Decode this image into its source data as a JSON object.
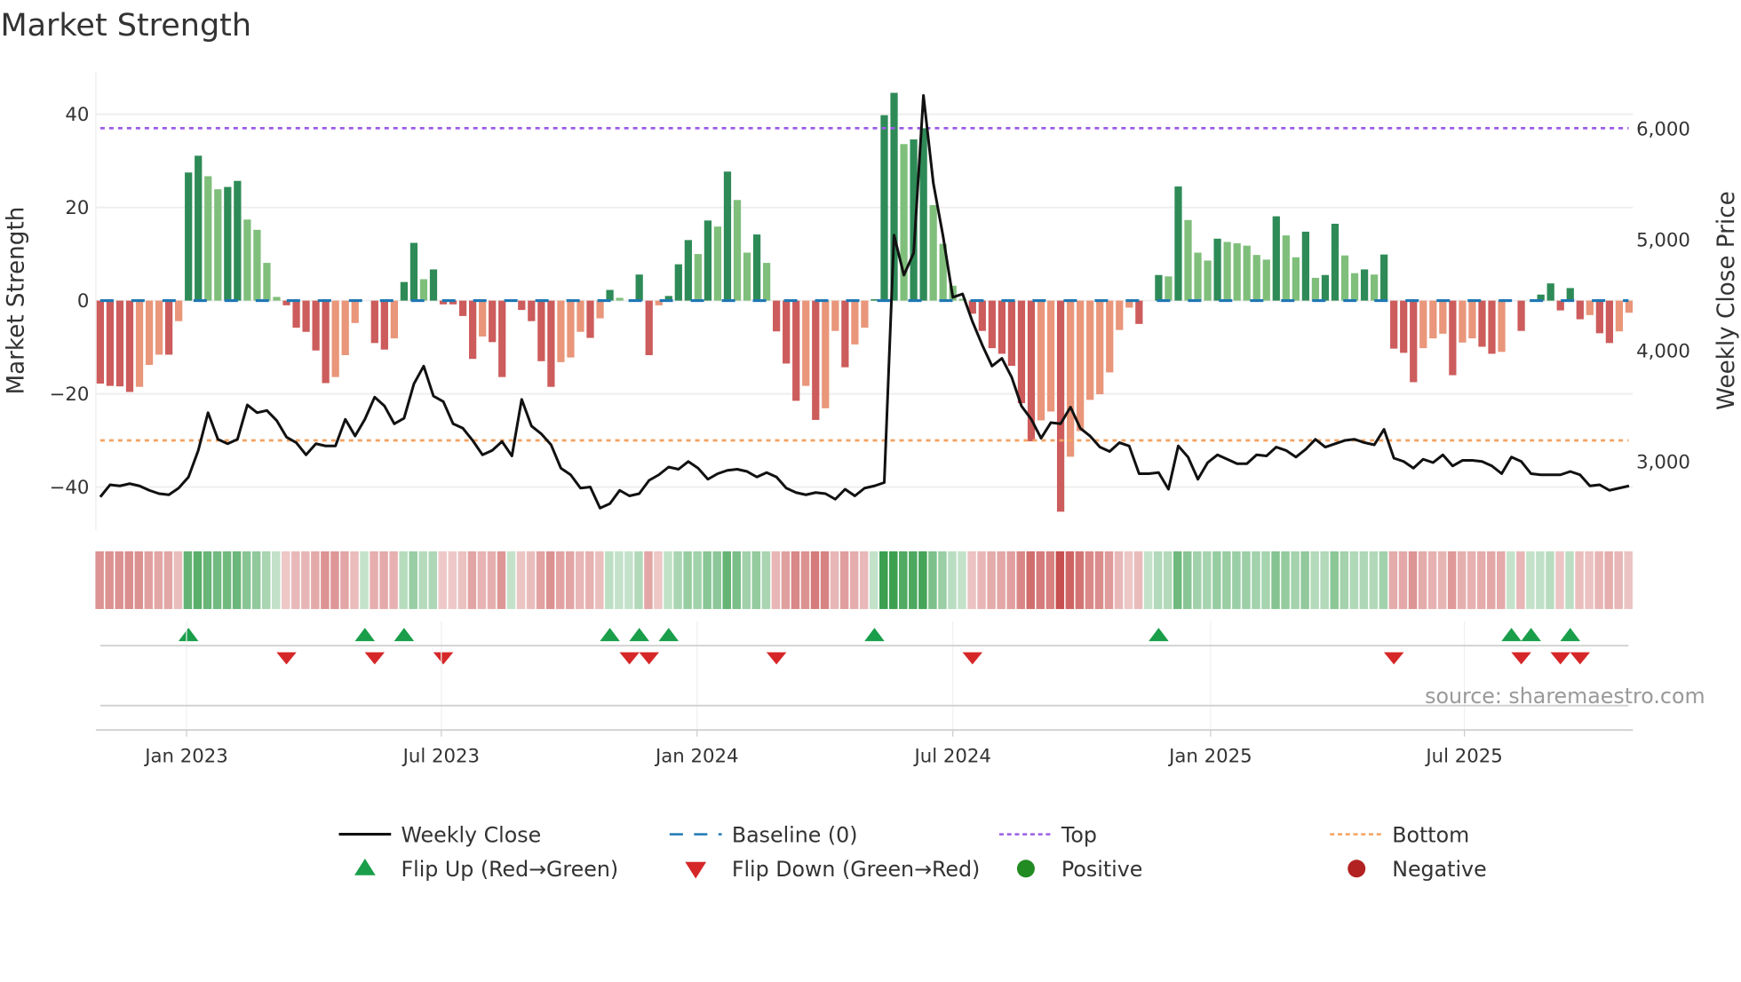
{
  "chart_data": {
    "type": "bar",
    "title": "Market Strength",
    "ylabel": "Market Strength",
    "y2label": "Weekly Close Price",
    "ylim": [
      -50,
      50
    ],
    "y2lim": [
      2450,
      6550
    ],
    "yticks": [
      40,
      20,
      0,
      -20,
      -40
    ],
    "yticklabels": [
      "40",
      "20",
      "0",
      "−20",
      "−40"
    ],
    "y2ticks": [
      6000,
      5000,
      4000,
      3000
    ],
    "y2ticklabels": [
      "6,000",
      "5,000",
      "4,000",
      "3,000"
    ],
    "xticks": [
      {
        "week": 8.8,
        "label": "Jan 2023"
      },
      {
        "week": 34.8,
        "label": "Jul 2023"
      },
      {
        "week": 60.9,
        "label": "Jan 2024"
      },
      {
        "week": 87.0,
        "label": "Jul 2024"
      },
      {
        "week": 113.3,
        "label": "Jan 2025"
      },
      {
        "week": 139.2,
        "label": "Jul 2025"
      }
    ],
    "top": 37,
    "bottom": -30,
    "baseline": 0,
    "strength": [
      -17.8,
      -18.3,
      -18.4,
      -19.6,
      -18.5,
      -13.8,
      -11.6,
      -11.6,
      -4.4,
      27.5,
      31.1,
      26.7,
      23.9,
      24.4,
      25.7,
      17.4,
      15.2,
      8.1,
      0.8,
      -1,
      -5.8,
      -6.7,
      -10.7,
      -17.7,
      -16.4,
      -11.7,
      -4.8,
      0,
      -9.1,
      -10.5,
      -8.1,
      4,
      12.4,
      4.6,
      6.7,
      -0.8,
      -0.8,
      -3.3,
      -12.5,
      -7.7,
      -8.9,
      -16.4,
      0,
      -2,
      -4.4,
      -13,
      -18.5,
      -13.2,
      -12.2,
      -6.7,
      -8,
      -3.8,
      2.3,
      0.6,
      0,
      5.6,
      -11.7,
      -1,
      1,
      7.8,
      13,
      10,
      17.2,
      15.9,
      27.7,
      21.6,
      10.3,
      14.2,
      8.1,
      -6.6,
      -13.5,
      -21.5,
      -18.3,
      -25.6,
      -23.1,
      -6.5,
      -14.3,
      -9.4,
      -5.8,
      0.3,
      39.8,
      44.6,
      33.6,
      34.6,
      37,
      20.5,
      12.2,
      3.2,
      0.4,
      -2.8,
      -6.5,
      -10.2,
      -11.4,
      -14,
      -22,
      -30.2,
      -25.7,
      -23.8,
      -45.3,
      -33.5,
      -28,
      -21.3,
      -20.1,
      -15.4,
      -6.3,
      -1.5,
      -5,
      0,
      5.5,
      5.2,
      24.5,
      17.3,
      10.3,
      8.6,
      13.3,
      12.6,
      12.3,
      11.8,
      9.8,
      8.8,
      18.1,
      14,
      9.3,
      14.8,
      4.9,
      5.5,
      16.5,
      9.7,
      5.9,
      6.7,
      5.6,
      9.9,
      -10.3,
      -11.2,
      -17.5,
      -10.2,
      -8.1,
      -7.1,
      -16,
      -9,
      -8.1,
      -9.9,
      -11.4,
      -11,
      0,
      -6.5,
      0,
      1.3,
      3.7,
      -2.1,
      2.7,
      -4,
      -3.1,
      -7,
      -9.1,
      -6.6,
      -2.6
    ],
    "strong": [
      1,
      1,
      1,
      1,
      0,
      0,
      0,
      1,
      0,
      1,
      1,
      0,
      0,
      1,
      1,
      0,
      0,
      0,
      0,
      1,
      1,
      1,
      1,
      1,
      0,
      0,
      0,
      0,
      1,
      1,
      0,
      1,
      1,
      0,
      1,
      1,
      1,
      1,
      1,
      0,
      1,
      1,
      0,
      1,
      1,
      1,
      1,
      0,
      0,
      0,
      1,
      0,
      1,
      0,
      0,
      1,
      1,
      0,
      1,
      1,
      1,
      0,
      1,
      0,
      1,
      0,
      0,
      1,
      0,
      1,
      1,
      1,
      0,
      1,
      0,
      0,
      1,
      0,
      0,
      1,
      1,
      1,
      0,
      1,
      1,
      0,
      0,
      0,
      0,
      1,
      1,
      1,
      1,
      1,
      1,
      1,
      0,
      0,
      1,
      0,
      0,
      0,
      0,
      0,
      0,
      0,
      1,
      0,
      1,
      0,
      1,
      0,
      0,
      0,
      1,
      0,
      0,
      0,
      0,
      0,
      1,
      0,
      0,
      1,
      0,
      1,
      1,
      0,
      0,
      1,
      0,
      1,
      1,
      1,
      1,
      0,
      0,
      0,
      1,
      0,
      0,
      1,
      1,
      0,
      0,
      1,
      0,
      1,
      1,
      1,
      1,
      1,
      0,
      1,
      1,
      0,
      0
    ],
    "weekly_close": [
      2680,
      2790,
      2780,
      2800,
      2780,
      2740,
      2710,
      2700,
      2760,
      2860,
      3100,
      3440,
      3200,
      3160,
      3200,
      3510,
      3440,
      3460,
      3370,
      3220,
      3170,
      3060,
      3160,
      3140,
      3140,
      3380,
      3230,
      3380,
      3580,
      3500,
      3340,
      3390,
      3700,
      3860,
      3590,
      3540,
      3340,
      3300,
      3190,
      3060,
      3100,
      3180,
      3050,
      3560,
      3320,
      3250,
      3150,
      2940,
      2880,
      2760,
      2770,
      2580,
      2620,
      2740,
      2690,
      2710,
      2830,
      2880,
      2950,
      2930,
      3000,
      2940,
      2840,
      2890,
      2920,
      2930,
      2910,
      2860,
      2900,
      2860,
      2760,
      2720,
      2700,
      2720,
      2710,
      2660,
      2750,
      2690,
      2760,
      2780,
      2810,
      5040,
      4680,
      4880,
      6300,
      5510,
      5030,
      4480,
      4510,
      4260,
      4050,
      3860,
      3930,
      3760,
      3500,
      3380,
      3210,
      3350,
      3340,
      3490,
      3300,
      3230,
      3130,
      3090,
      3170,
      3140,
      2890,
      2890,
      2900,
      2750,
      3140,
      3040,
      2840,
      2990,
      3060,
      3020,
      2980,
      2980,
      3060,
      3050,
      3130,
      3100,
      3040,
      3110,
      3200,
      3130,
      3160,
      3190,
      3200,
      3170,
      3150,
      3290,
      3030,
      3000,
      2940,
      3020,
      2990,
      3060,
      2960,
      3010,
      3010,
      3000,
      2960,
      2890,
      3040,
      3000,
      2890,
      2880,
      2880,
      2880,
      2910,
      2880,
      2780,
      2790,
      2740,
      2760,
      2780
    ],
    "flip_up_weeks": [
      9,
      27,
      31,
      52,
      55,
      58,
      79,
      108,
      144,
      146,
      150
    ],
    "flip_down_weeks": [
      19,
      28,
      35,
      54,
      56,
      69,
      89,
      132,
      145,
      149,
      151
    ],
    "colors": {
      "strong_pos": "#2e8b57",
      "weak_pos": "#7fbf7b",
      "strong_neg": "#cd5c5c",
      "weak_neg": "#e9967a",
      "baseline": "#1f77b4",
      "top": "#9b5de5",
      "bottom": "#f4a261",
      "line": "#111111",
      "flip_up": "#1a9e4a",
      "flip_down": "#d62728",
      "positive": "#228b22",
      "negative": "#b22222"
    },
    "legend": [
      {
        "key": "line",
        "label": "Weekly Close"
      },
      {
        "key": "baseline",
        "label": "Baseline (0)"
      },
      {
        "key": "top",
        "label": "Top"
      },
      {
        "key": "bottom",
        "label": "Bottom"
      },
      {
        "key": "flip_up",
        "label": "Flip Up (Red→Green)"
      },
      {
        "key": "flip_down",
        "label": "Flip Down (Green→Red)"
      },
      {
        "key": "positive",
        "label": "Positive"
      },
      {
        "key": "negative",
        "label": "Negative"
      }
    ],
    "source": "source: sharemaestro.com"
  }
}
